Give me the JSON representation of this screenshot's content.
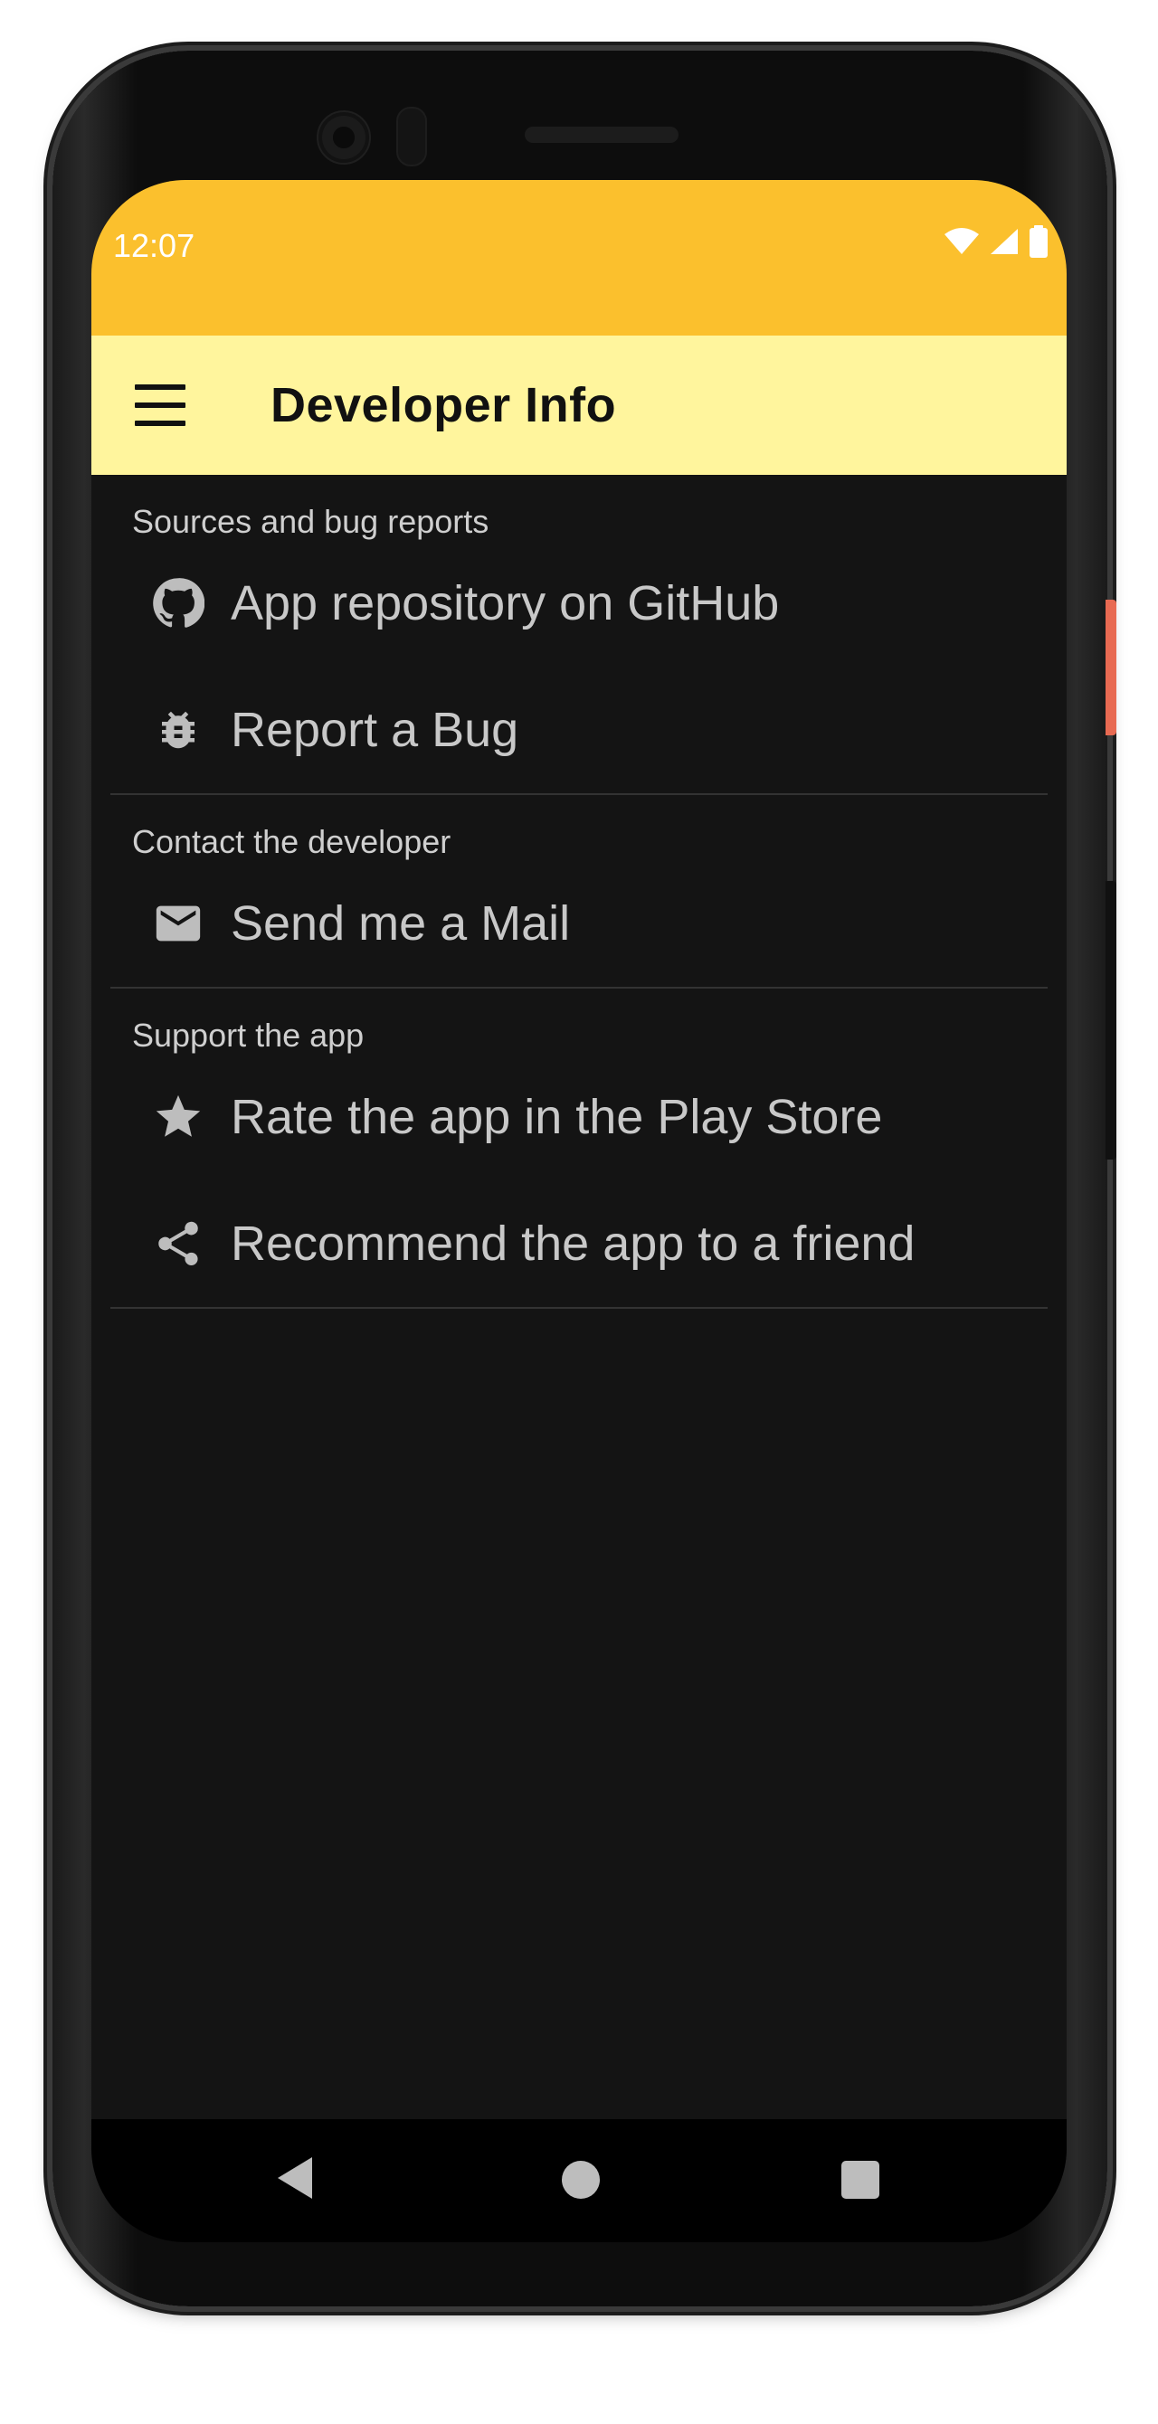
{
  "status_bar": {
    "time": "12:07",
    "icons": [
      "wifi-icon",
      "signal-icon",
      "battery-icon"
    ],
    "color": "#fbc02d"
  },
  "app_bar": {
    "title": "Developer Info",
    "menu_icon": "hamburger-menu-icon",
    "color": "#fff59d"
  },
  "sections": [
    {
      "header": "Sources and bug reports",
      "items": [
        {
          "icon": "github-icon",
          "label": "App repository on GitHub"
        },
        {
          "icon": "bug-icon",
          "label": "Report a Bug"
        }
      ]
    },
    {
      "header": "Contact the developer",
      "items": [
        {
          "icon": "mail-icon",
          "label": "Send me a Mail"
        }
      ]
    },
    {
      "header": "Support the app",
      "items": [
        {
          "icon": "star-icon",
          "label": "Rate the app in the Play Store"
        },
        {
          "icon": "share-icon",
          "label": "Recommend the app to a friend"
        }
      ]
    }
  ],
  "nav_bar": {
    "buttons": [
      "back-icon",
      "home-icon",
      "recents-icon"
    ]
  },
  "colors": {
    "background": "#141414",
    "text": "#c8c8c8",
    "divider": "#333333"
  }
}
